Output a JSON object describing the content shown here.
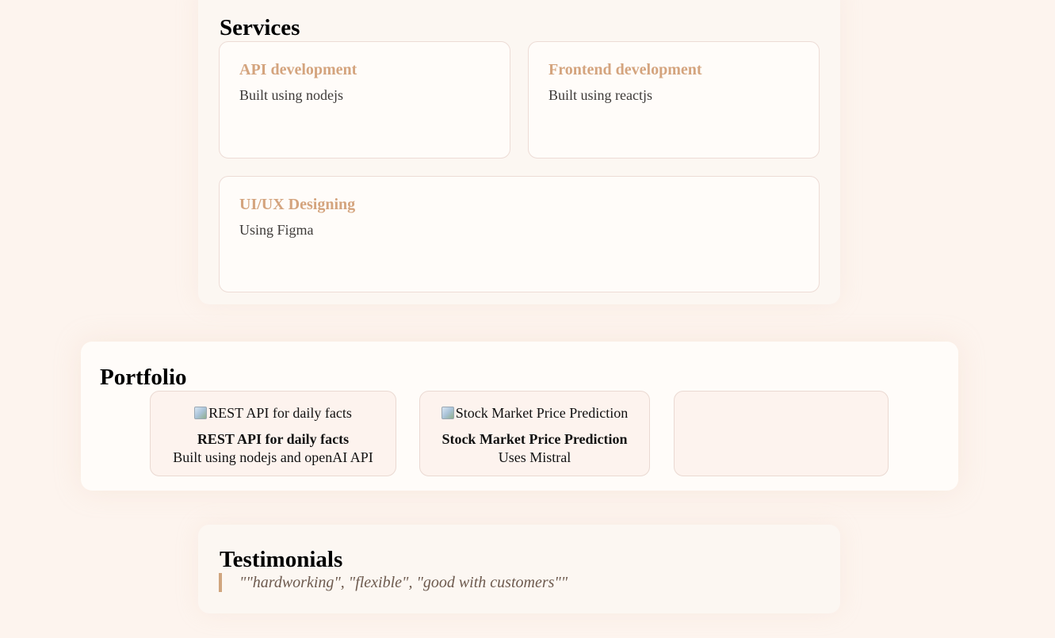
{
  "services": {
    "heading": "Services",
    "items": [
      {
        "title": "API development",
        "desc": "Built using nodejs"
      },
      {
        "title": "Frontend development",
        "desc": "Built using reactjs"
      },
      {
        "title": "UI/UX Designing",
        "desc": "Using Figma"
      }
    ]
  },
  "portfolio": {
    "heading": "Portfolio",
    "projects": [
      {
        "img_alt": "REST API for daily facts",
        "name": "REST API for daily facts",
        "desc": "Built using nodejs and openAI API"
      },
      {
        "img_alt": "Stock Market Price Prediction",
        "name": "Stock Market Price Prediction",
        "desc": "Uses Mistral"
      },
      {
        "img_alt": "",
        "name": "",
        "desc": ""
      }
    ]
  },
  "testimonials": {
    "heading": "Testimonials",
    "quote": "\"\"hardworking\", \"flexible\", \"good with customers\"\""
  }
}
